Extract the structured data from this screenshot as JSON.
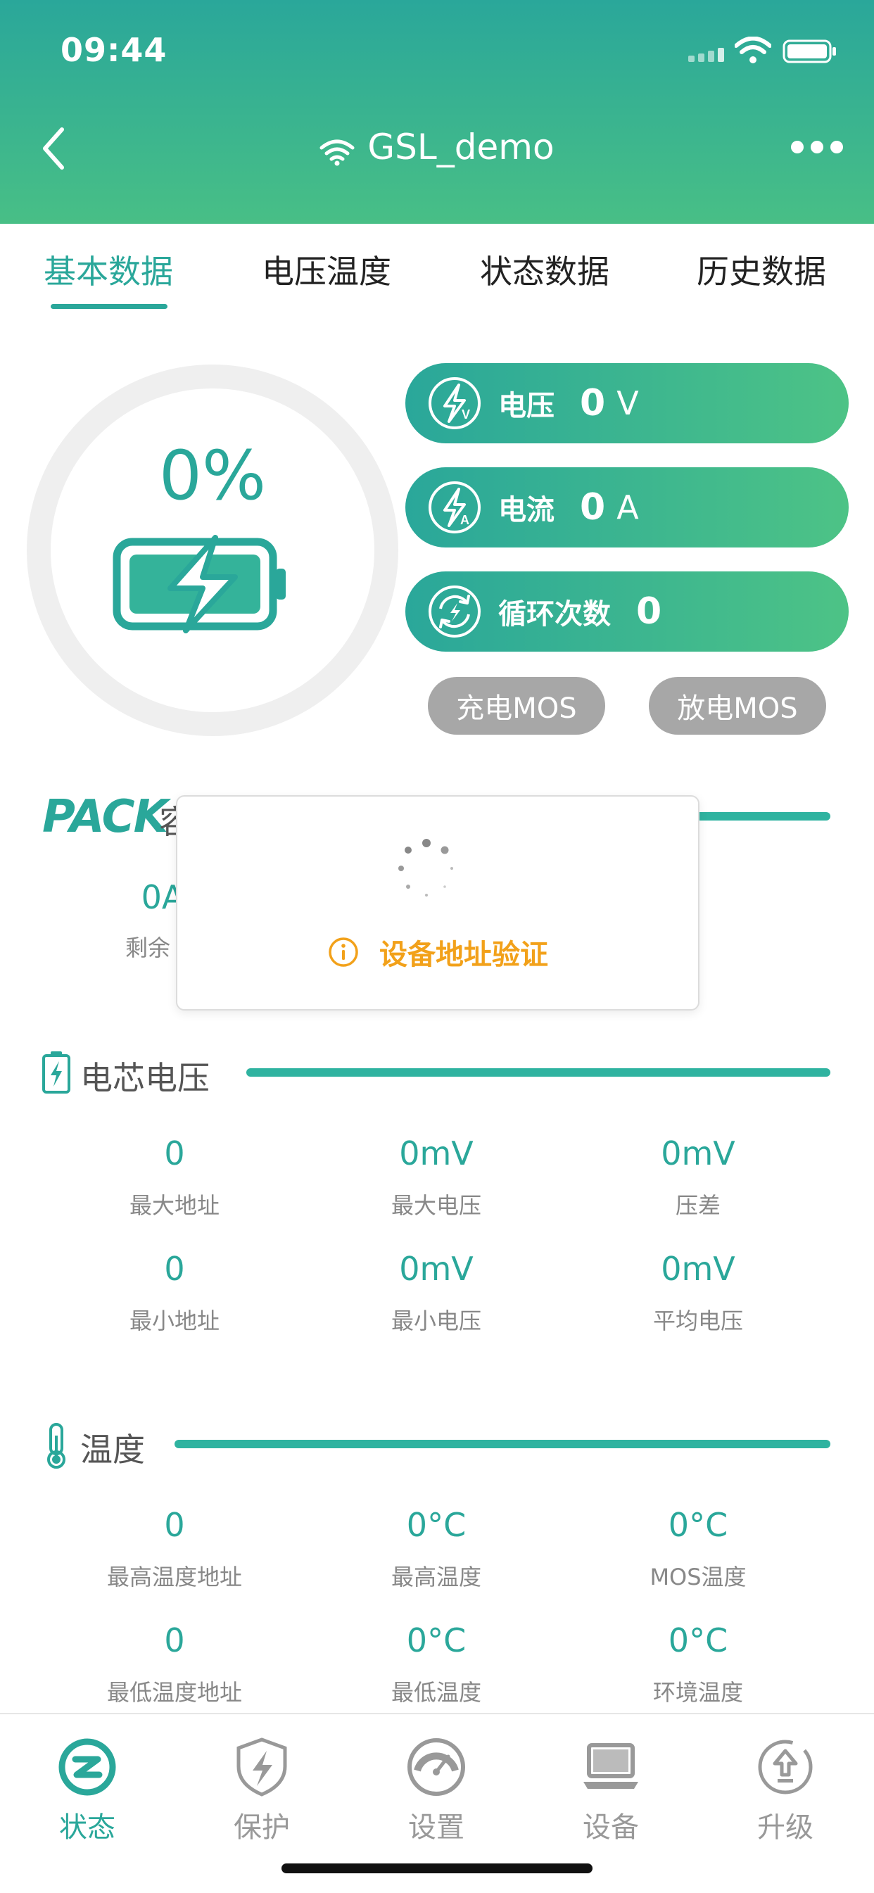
{
  "status_bar": {
    "time": "09:44"
  },
  "header": {
    "title": "GSL_demo"
  },
  "tabs": [
    {
      "label": "基本数据",
      "active": true
    },
    {
      "label": "电压温度",
      "active": false
    },
    {
      "label": "状态数据",
      "active": false
    },
    {
      "label": "历史数据",
      "active": false
    }
  ],
  "gauge": {
    "percent_text": "0%",
    "percent": 0
  },
  "pills": {
    "voltage": {
      "label": "电压",
      "value": "0",
      "unit": "V"
    },
    "current": {
      "label": "电流",
      "value": "0",
      "unit": "A"
    },
    "cycles": {
      "label": "循环次数",
      "value": "0"
    }
  },
  "mos": {
    "charge": "充电MOS",
    "discharge": "放电MOS"
  },
  "pack": {
    "logo": "PACK",
    "title_fragment": "容",
    "value_fragment": "0A",
    "label_fragment": "剩余"
  },
  "dialog": {
    "message": "设备地址验证"
  },
  "cell_voltage": {
    "title": "电芯电压",
    "cells": [
      {
        "value": "0",
        "label": "最大地址"
      },
      {
        "value": "0mV",
        "label": "最大电压"
      },
      {
        "value": "0mV",
        "label": "压差"
      },
      {
        "value": "0",
        "label": "最小地址"
      },
      {
        "value": "0mV",
        "label": "最小电压"
      },
      {
        "value": "0mV",
        "label": "平均电压"
      }
    ]
  },
  "temperature": {
    "title": "温度",
    "cells": [
      {
        "value": "0",
        "label": "最高温度地址"
      },
      {
        "value": "0°C",
        "label": "最高温度"
      },
      {
        "value": "0°C",
        "label": "MOS温度"
      },
      {
        "value": "0",
        "label": "最低温度地址"
      },
      {
        "value": "0°C",
        "label": "最低温度"
      },
      {
        "value": "0°C",
        "label": "环境温度"
      }
    ]
  },
  "bottom_nav": [
    {
      "label": "状态",
      "icon": "status-icon",
      "active": true
    },
    {
      "label": "保护",
      "icon": "shield-bolt-icon",
      "active": false
    },
    {
      "label": "设置",
      "icon": "gauge-icon",
      "active": false
    },
    {
      "label": "设备",
      "icon": "laptop-icon",
      "active": false
    },
    {
      "label": "升级",
      "icon": "upgrade-icon",
      "active": false
    }
  ],
  "colors": {
    "accent": "#2aa79a",
    "accent_light": "#48bf86",
    "warning": "#f2a11a",
    "inactive": "#a7a7a7"
  }
}
